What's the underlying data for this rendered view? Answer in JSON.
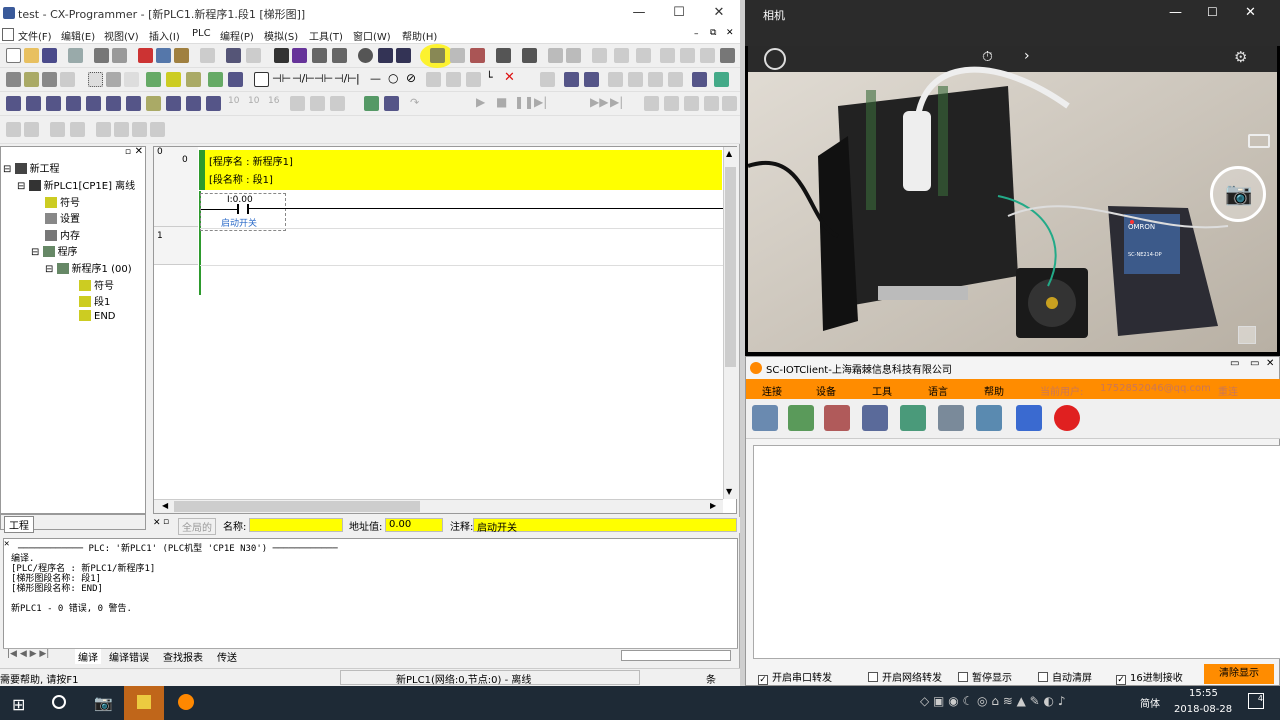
{
  "cx": {
    "title": "test - CX-Programmer - [新PLC1.新程序1.段1 [梯形图]]",
    "menu": [
      "文件(F)",
      "编辑(E)",
      "视图(V)",
      "插入(I)",
      "PLC",
      "编程(P)",
      "模拟(S)",
      "工具(T)",
      "窗口(W)",
      "帮助(H)"
    ],
    "tree": {
      "root": "新工程",
      "plc": "新PLC1[CP1E] 离线",
      "symbols": "符号",
      "settings": "设置",
      "memory": "内存",
      "programs": "程序",
      "program1": "新程序1 (00)",
      "p_symbols": "符号",
      "section1": "段1",
      "end": "END",
      "tab": "工程"
    },
    "ladder": {
      "rung0": "0",
      "rung0_step": "0",
      "rung1": "1",
      "program_name": "[程序名 : 新程序1]",
      "section_name": "[段名称 : 段1]",
      "contact_addr": "I:0.00",
      "contact_comment": "启动开关"
    },
    "fields": {
      "global": "全局的",
      "name_label": "名称:",
      "name_value": "",
      "addr_label": "地址值:",
      "addr_value": "0.00",
      "comment_label": "注释:",
      "comment_value": "启动开关"
    },
    "output": {
      "header": "PLC: '新PLC1' (PLC机型 'CP1E N30')",
      "lines": [
        "编译.",
        "[PLC/程序名 : 新PLC1/新程序1]",
        "[梯形图段名称: 段1]",
        "[梯形图段名称: END]",
        "",
        "新PLC1 - 0 错误, 0 警告."
      ],
      "tabs": [
        "编译",
        "编译错误",
        "查找报表",
        "传送"
      ]
    },
    "status": {
      "help": "需要帮助, 请按F1",
      "net": "新PLC1(网络:0,节点:0) - 离线",
      "extra": "条"
    }
  },
  "camera": {
    "title": "相机",
    "timer_icon": "timer-icon",
    "device_label_1": "OMRON",
    "device_label_2": "SC-NE214-DP"
  },
  "iot": {
    "title": "SC-IOTClient-上海霜棘信息科技有限公司",
    "menu": [
      "连接",
      "设备",
      "工具",
      "语言",
      "帮助"
    ],
    "user_label": "当前用户:",
    "user_value": "1752852046@qq.com",
    "relogin": "重连",
    "checks": [
      {
        "label": "开启串口转发",
        "checked": true
      },
      {
        "label": "开启网络转发",
        "checked": false
      },
      {
        "label": "暂停显示",
        "checked": false
      },
      {
        "label": "自动清屏",
        "checked": false
      },
      {
        "label": "16进制接收",
        "checked": true
      }
    ],
    "clear_btn": "清除显示"
  },
  "taskbar": {
    "time": "15:55",
    "date": "2018-08-28",
    "ime": "简体",
    "notif_count": "4"
  }
}
